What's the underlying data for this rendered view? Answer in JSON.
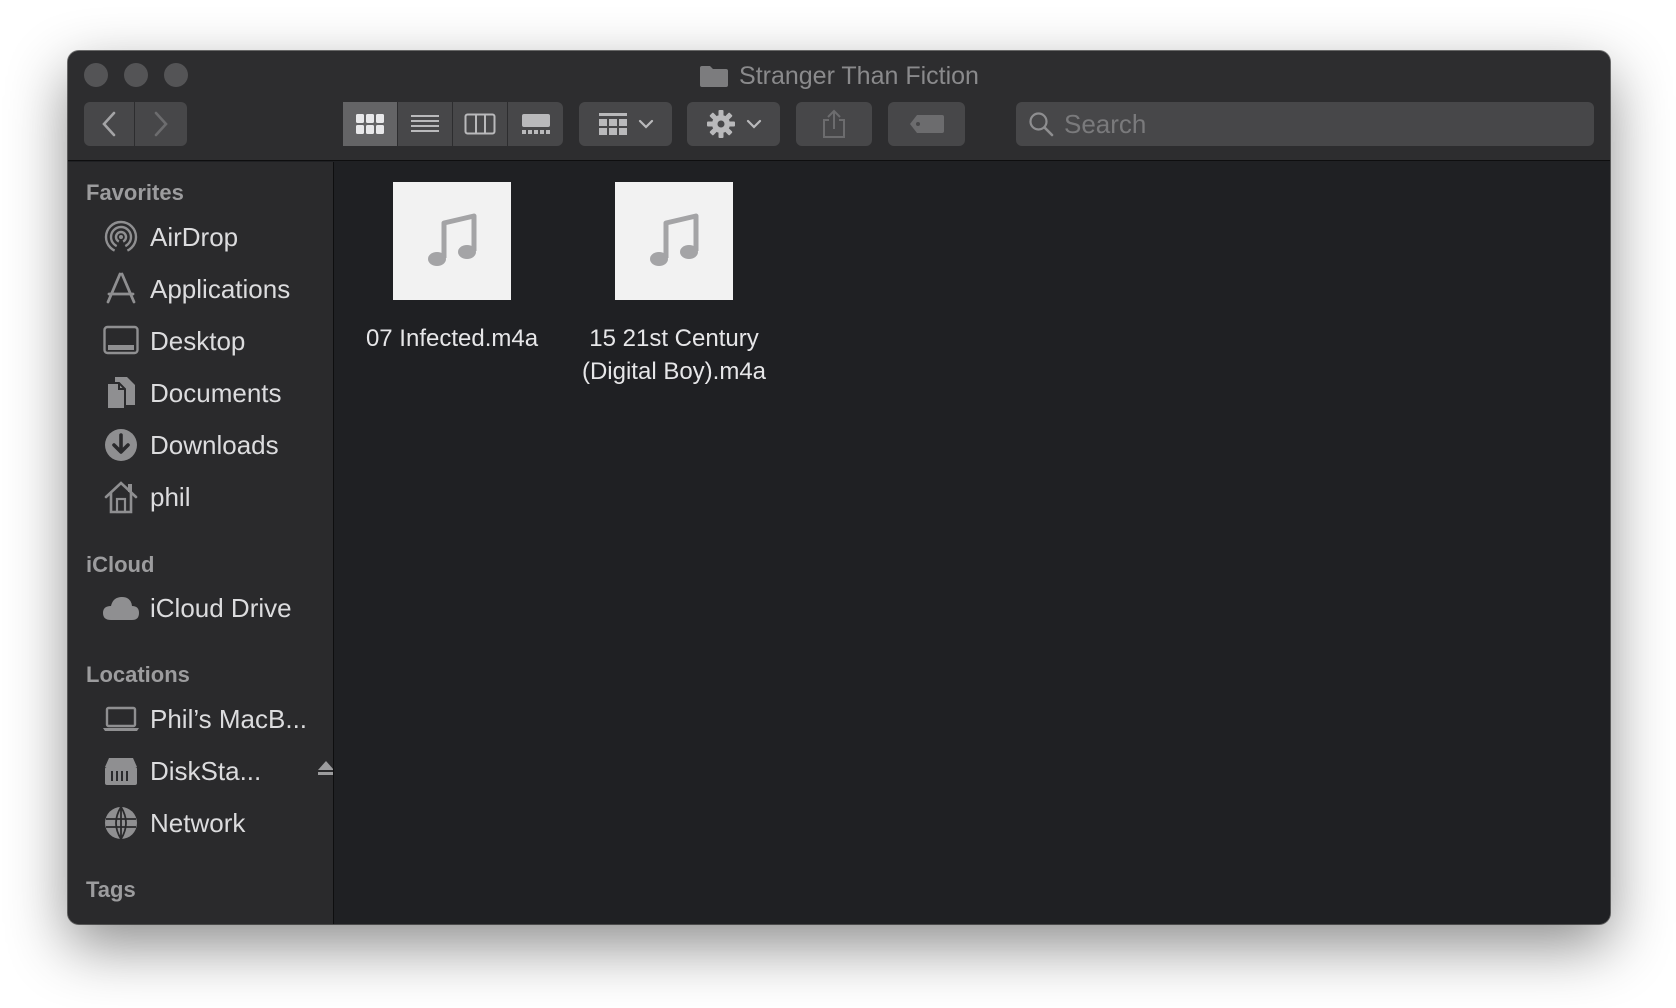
{
  "window": {
    "title": "Stranger Than Fiction"
  },
  "search": {
    "placeholder": "Search"
  },
  "sidebar": {
    "sections": {
      "favorites": "Favorites",
      "icloud": "iCloud",
      "locations": "Locations",
      "tags": "Tags"
    },
    "favorites": [
      {
        "label": "AirDrop",
        "icon": "airdrop-icon"
      },
      {
        "label": "Applications",
        "icon": "applications-icon"
      },
      {
        "label": "Desktop",
        "icon": "desktop-icon"
      },
      {
        "label": "Documents",
        "icon": "documents-icon"
      },
      {
        "label": "Downloads",
        "icon": "downloads-icon"
      },
      {
        "label": "phil",
        "icon": "home-icon"
      }
    ],
    "icloud": [
      {
        "label": "iCloud Drive",
        "icon": "cloud-icon"
      }
    ],
    "locations": [
      {
        "label": "Phil’s MacB...",
        "icon": "laptop-icon"
      },
      {
        "label": "DiskSta...",
        "icon": "nas-icon"
      },
      {
        "label": "Network",
        "icon": "network-icon"
      }
    ]
  },
  "files": [
    {
      "name": "07 Infected.m4a",
      "icon": "music-note-icon"
    },
    {
      "name": "15 21st Century\n(Digital Boy).m4a",
      "icon": "music-note-icon"
    }
  ],
  "colors": {
    "window_bg": "#1f2023",
    "toolbar_bg": "#2d2d2f",
    "sidebar_bg": "#2a2a2c",
    "tag_purple": "#c86fe3"
  }
}
